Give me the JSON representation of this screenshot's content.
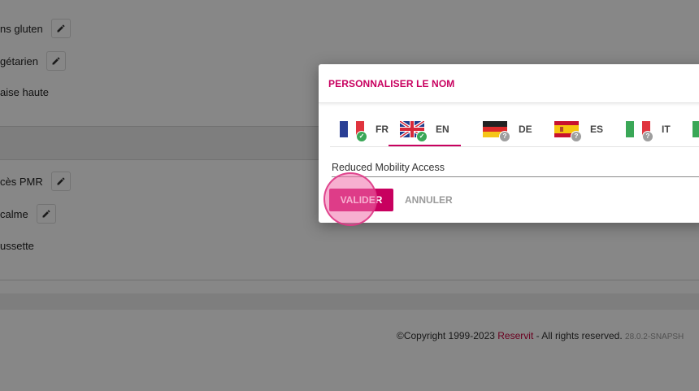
{
  "background_list": {
    "items": [
      {
        "label": "ns gluten",
        "editable": true
      },
      {
        "label": "gétarien",
        "editable": true
      },
      {
        "label": "aise haute",
        "editable": false
      },
      {
        "label": "cès PMR",
        "editable": true
      },
      {
        "label": " calme",
        "editable": true
      },
      {
        "label": "ussette",
        "editable": false
      }
    ]
  },
  "footer": {
    "copyright": "©Copyright 1999-2023",
    "brand": "Reservit",
    "rights": "- All rights reserved.",
    "version": "28.0.2-SNAPSH"
  },
  "dialog": {
    "title": "PERSONNALISER LE NOM",
    "tabs": [
      {
        "code": "FR",
        "status": "done",
        "icon": "flag-france-icon"
      },
      {
        "code": "EN",
        "status": "done",
        "icon": "flag-uk-icon",
        "active": true
      },
      {
        "code": "DE",
        "status": "unknown",
        "icon": "flag-germany-icon"
      },
      {
        "code": "ES",
        "status": "unknown",
        "icon": "flag-spain-icon"
      },
      {
        "code": "IT",
        "status": "unknown",
        "icon": "flag-italy-icon"
      }
    ],
    "name_field": {
      "value": "Reduced Mobility Access"
    },
    "validate_label": "VALIDER",
    "cancel_label": "ANNULER"
  },
  "colors": {
    "accent": "#c8005f",
    "success": "#3aa757",
    "unknown": "#9e9e9e"
  }
}
